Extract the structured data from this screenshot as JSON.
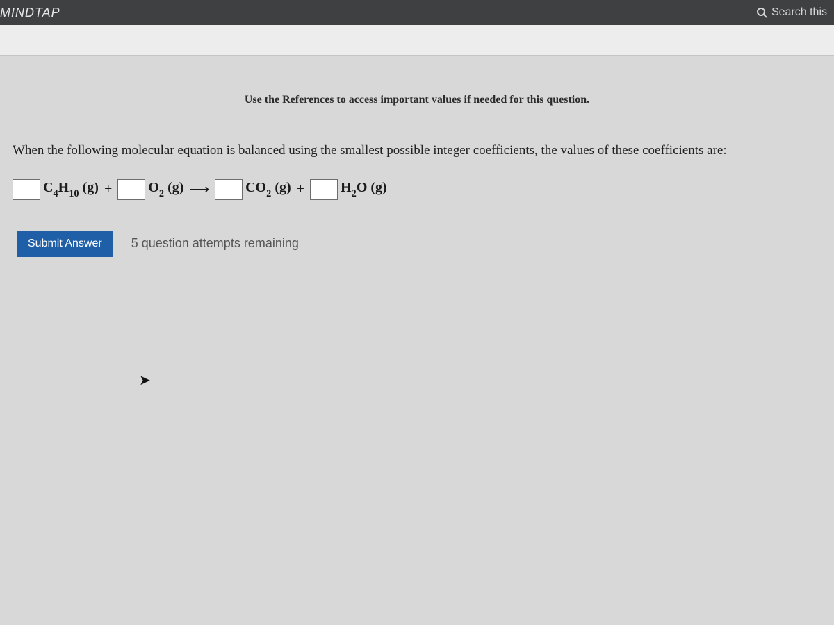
{
  "header": {
    "brand": "MINDTAP",
    "search_label": "Search this"
  },
  "instruction": "Use the References to access important values if needed for this question.",
  "question_text": "When the following molecular equation is balanced using the smallest possible integer coefficients, the values of these coefficients are:",
  "equation": {
    "term1": {
      "formula_base": "C",
      "sub1": "4",
      "mid": "H",
      "sub2": "10",
      "state": "(g)"
    },
    "plus1": "+",
    "term2": {
      "formula_base": "O",
      "sub1": "2",
      "state": "(g)"
    },
    "arrow": "⟶",
    "term3": {
      "formula_base": "CO",
      "sub1": "2",
      "state": "(g)"
    },
    "plus2": "+",
    "term4": {
      "formula_base": "H",
      "sub1": "2",
      "mid": "O",
      "state": "(g)"
    }
  },
  "submit_label": "Submit Answer",
  "attempts_text": "5 question attempts remaining"
}
